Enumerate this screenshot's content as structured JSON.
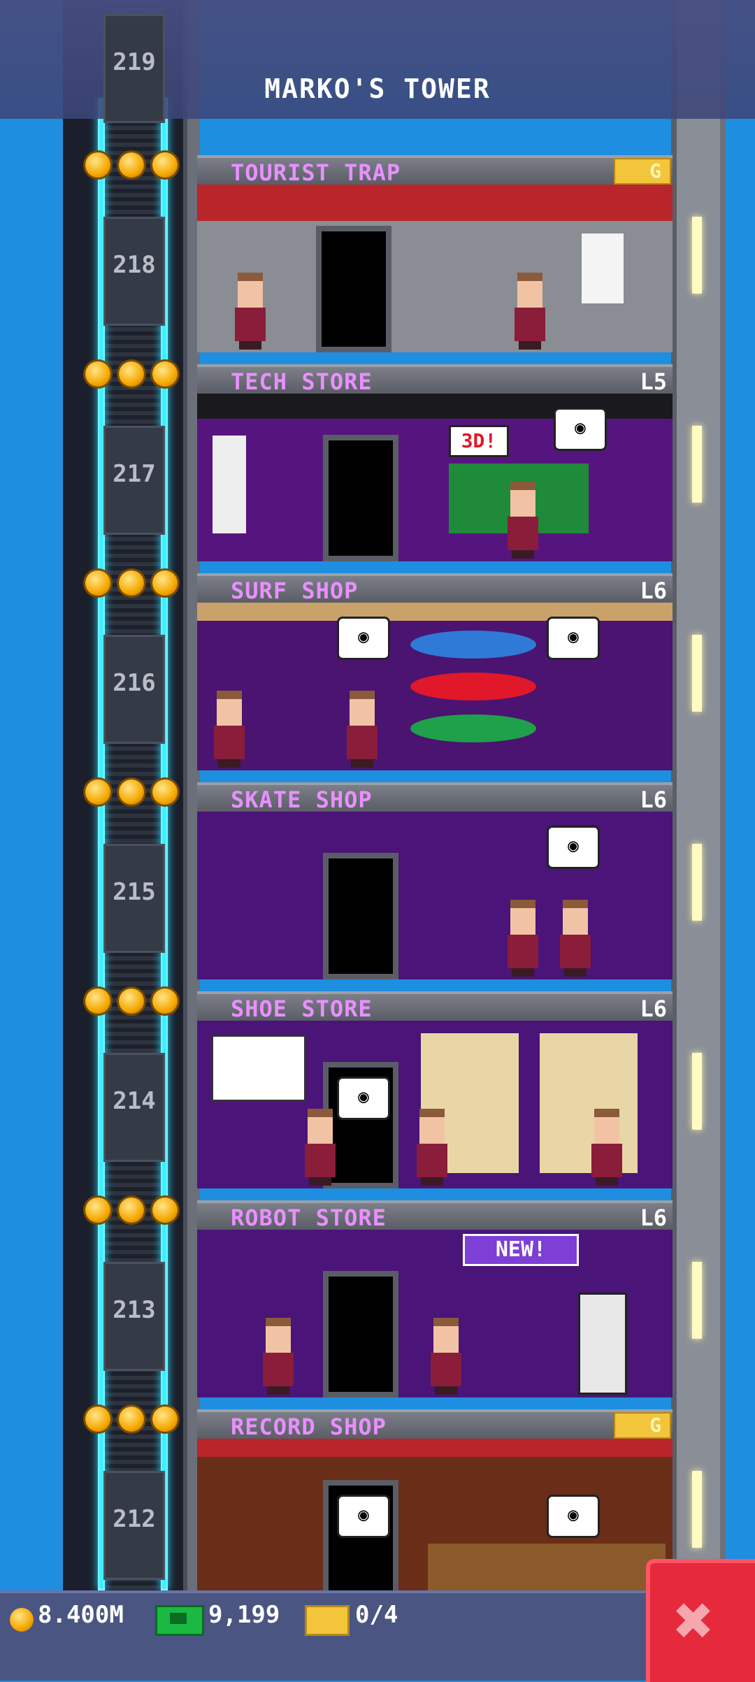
{
  "header": {
    "title": "MARKO'S TOWER",
    "top_floor_number": "219"
  },
  "floors": [
    {
      "number": "218",
      "name": "TOURIST TRAP",
      "level": "",
      "gold": "G"
    },
    {
      "number": "217",
      "name": "TECH STORE",
      "level": "L5",
      "gold": ""
    },
    {
      "number": "216",
      "name": "SURF SHOP",
      "level": "L6",
      "gold": ""
    },
    {
      "number": "215",
      "name": "SKATE SHOP",
      "level": "L6",
      "gold": ""
    },
    {
      "number": "214",
      "name": "SHOE STORE",
      "level": "L6",
      "gold": ""
    },
    {
      "number": "213",
      "name": "ROBOT STORE",
      "level": "L6",
      "gold": ""
    },
    {
      "number": "212",
      "name": "RECORD SHOP",
      "level": "",
      "gold": "G"
    }
  ],
  "signs": {
    "tech_3d": "3D!",
    "robot_new": "NEW!"
  },
  "status_bar": {
    "coins": "8.400M",
    "bux": "9,199",
    "tickets": "0/4"
  },
  "colors": {
    "sky": "#1e8fe0",
    "shop_name": "#e890ff",
    "cable": "#35f0ff",
    "close": "#e62a3c"
  },
  "icons": {
    "close": "close-icon",
    "coin": "coin-icon",
    "bux": "bux-icon",
    "ticket": "ticket-icon"
  }
}
